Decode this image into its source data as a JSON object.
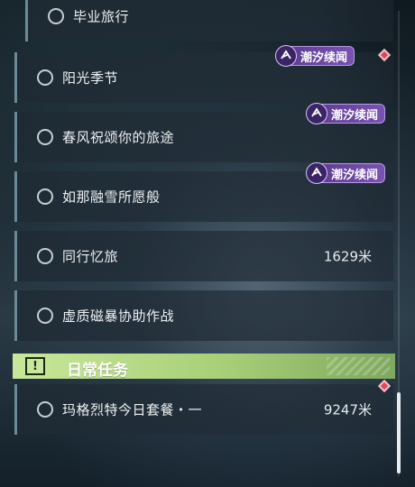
{
  "tasks": [
    {
      "label": "毕业旅行",
      "distance": ""
    },
    {
      "label": "阳光季节",
      "distance": ""
    },
    {
      "label": "春风祝颂你的旅途",
      "distance": ""
    },
    {
      "label": "如那融雪所愿般",
      "distance": ""
    },
    {
      "label": "同行忆旅",
      "distance": "1629米"
    },
    {
      "label": "虚质磁暴协助作战",
      "distance": ""
    }
  ],
  "badge_text": "潮汐续闻",
  "daily": {
    "title": "日常任务",
    "icon_glyph": "!",
    "items": [
      {
        "label": "玛格烈特今日套餐・一",
        "distance": "9247米"
      }
    ]
  },
  "colors": {
    "accent_green": "#c9e79a",
    "badge_purple": "#7a52b3",
    "pin_red": "#d94a5e"
  },
  "icons": [
    "circle-icon",
    "tide-badge-icon",
    "alert-icon",
    "pin-icon"
  ]
}
